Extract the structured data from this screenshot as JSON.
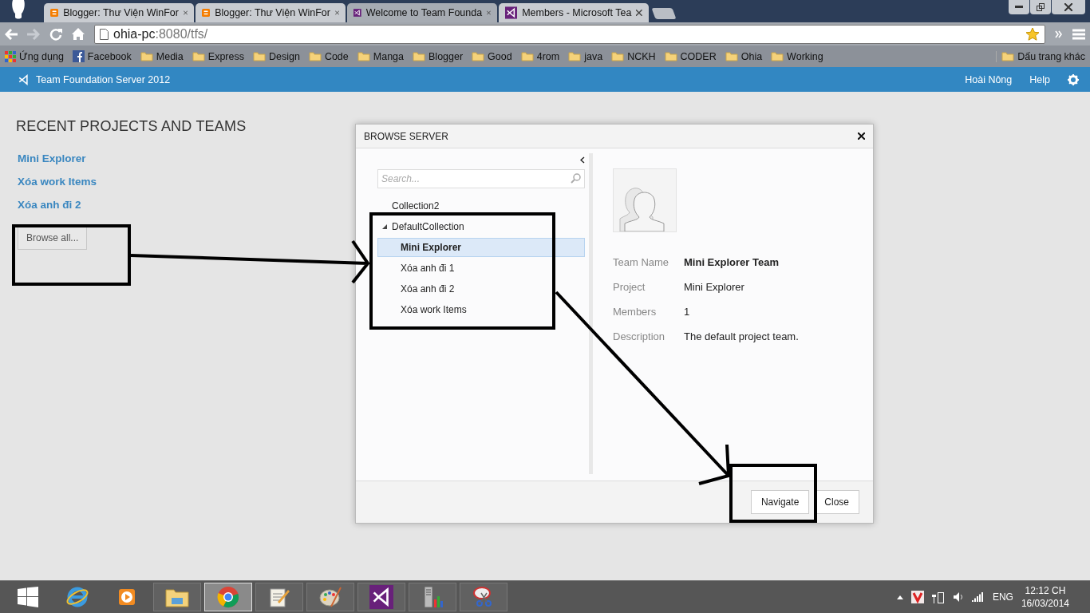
{
  "browser": {
    "tabs": [
      {
        "title": "Blogger: Thư Viện WinFor",
        "kind": "blogger",
        "selected": false
      },
      {
        "title": "Blogger: Thư Viện WinFor",
        "kind": "blogger",
        "selected": false
      },
      {
        "title": "Welcome to Team Founda",
        "kind": "vs",
        "selected": true
      },
      {
        "title": "Members - Microsoft Tea",
        "kind": "vs",
        "selected": false
      }
    ],
    "address": {
      "host": "ohia-pc",
      "path": ":8080/tfs/"
    },
    "bookmarks": [
      {
        "label": "Ứng dụng",
        "kind": "apps"
      },
      {
        "label": "Facebook",
        "kind": "facebook"
      },
      {
        "label": "Media",
        "kind": "folder"
      },
      {
        "label": "Express",
        "kind": "folder"
      },
      {
        "label": "Design",
        "kind": "folder"
      },
      {
        "label": "Code",
        "kind": "folder"
      },
      {
        "label": "Manga",
        "kind": "folder"
      },
      {
        "label": "Blogger",
        "kind": "folder"
      },
      {
        "label": "Good",
        "kind": "folder"
      },
      {
        "label": "4rom",
        "kind": "folder"
      },
      {
        "label": "java",
        "kind": "folder"
      },
      {
        "label": "NCKH",
        "kind": "folder"
      },
      {
        "label": "CODER",
        "kind": "folder"
      },
      {
        "label": "Ohia",
        "kind": "folder"
      },
      {
        "label": "Working",
        "kind": "folder"
      }
    ],
    "other_bookmarks": "Dấu trang khác"
  },
  "app_header": {
    "title": "Team Foundation Server 2012",
    "user": "Hoài Nông",
    "help": "Help"
  },
  "page": {
    "recent_heading": "RECENT PROJECTS AND TEAMS",
    "recent_links": [
      "Mini Explorer",
      "Xóa work Items",
      "Xóa anh đi 2"
    ],
    "browse_button": "Browse all..."
  },
  "dialog": {
    "title": "BROWSE SERVER",
    "search": {
      "placeholder": "Search..."
    },
    "tree": [
      {
        "label": "Collection2",
        "selected": false
      },
      {
        "label": "DefaultCollection",
        "selected": false,
        "expanded": true,
        "children": [
          {
            "label": "Mini Explorer",
            "selected": true
          },
          {
            "label": "Xóa anh đi 1",
            "selected": false
          },
          {
            "label": "Xóa anh đi 2",
            "selected": false
          },
          {
            "label": "Xóa work Items",
            "selected": false
          }
        ]
      }
    ],
    "details": [
      {
        "label": "Team Name",
        "value": "Mini Explorer Team",
        "kind": "title"
      },
      {
        "label": "Project",
        "value": "Mini Explorer",
        "kind": "text"
      },
      {
        "label": "Members",
        "value": "1",
        "kind": "text"
      },
      {
        "label": "Description",
        "value": "The default project team.",
        "kind": "text"
      }
    ],
    "buttons": [
      {
        "label": "Navigate"
      },
      {
        "label": "Close"
      }
    ]
  },
  "taskbar": {
    "apps": [
      {
        "kind": "explorer",
        "active": false
      },
      {
        "kind": "chrome",
        "active": true
      },
      {
        "kind": "notepad",
        "active": false
      },
      {
        "kind": "paint",
        "active": false
      },
      {
        "kind": "vs",
        "active": false
      },
      {
        "kind": "server",
        "active": false
      },
      {
        "kind": "snipping",
        "active": false
      }
    ],
    "language": "ENG",
    "time": "12:12 CH",
    "date": "16/03/2014"
  }
}
